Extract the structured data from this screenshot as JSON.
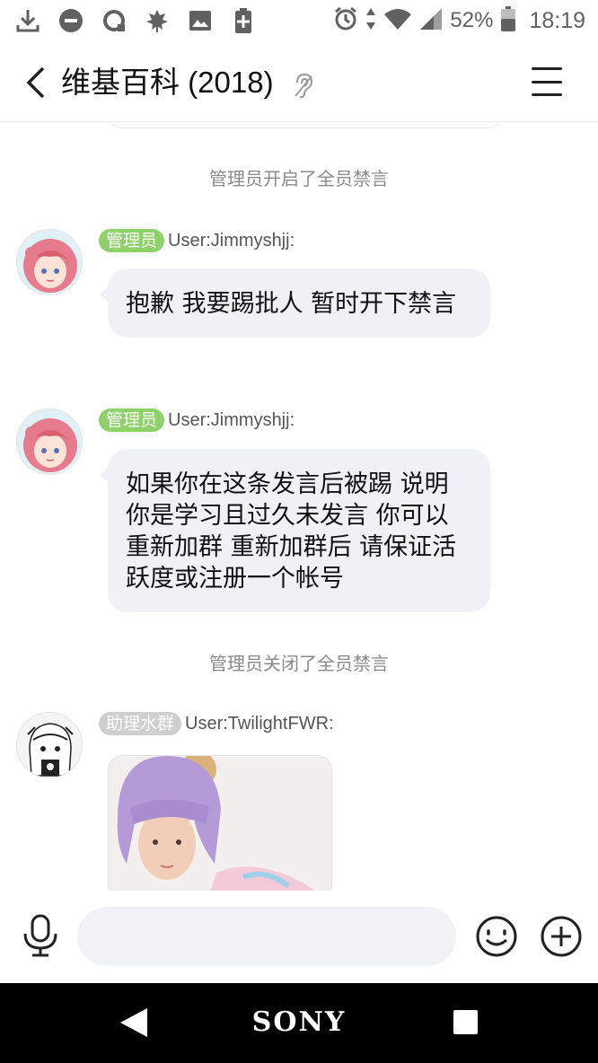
{
  "status_bar": {
    "left_icons": [
      "download-icon",
      "do-not-disturb-icon",
      "sync-icon",
      "leaf-icon",
      "image-icon",
      "battery-saver-icon"
    ],
    "right_icons": [
      "alarm-icon",
      "data-arrows-icon",
      "wifi-icon",
      "signal-icon",
      "battery-icon"
    ],
    "battery": "52%",
    "time": "18:19"
  },
  "header": {
    "title": "维基百科 (2018)",
    "back_icon": "chevron-left-icon",
    "ear_icon": "ear-icon",
    "menu_icon": "hamburger-menu-icon"
  },
  "chat": {
    "system_msg_1": "管理员开启了全员禁言",
    "message_1": {
      "badge": "管理员",
      "sender": "User:Jimmyshjj:",
      "text": "抱歉 我要踢批人 暂时开下禁言"
    },
    "message_2": {
      "badge": "管理员",
      "sender": "User:Jimmyshjj:",
      "text": "如果你在这条发言后被踢 说明你是学习且过久未发言 你可以重新加群 重新加群后 请保证活跃度或注册一个帐号"
    },
    "system_msg_2": "管理员关闭了全员禁言",
    "message_3": {
      "badge": "助理水群",
      "sender": "User:TwilightFWR:"
    }
  },
  "input_bar": {
    "placeholder": "",
    "mic_icon": "microphone-icon",
    "emoji_icon": "emoji-icon",
    "plus_icon": "plus-circle-icon"
  },
  "nav_bar": {
    "brand": "SONY",
    "back_icon": "nav-back-icon",
    "recents_icon": "nav-recents-icon"
  },
  "colors": {
    "admin_badge": "#8ed06a",
    "assistant_badge": "#cfcfcf",
    "bubble": "#eff1f6",
    "system_text": "#8a8a8a"
  }
}
